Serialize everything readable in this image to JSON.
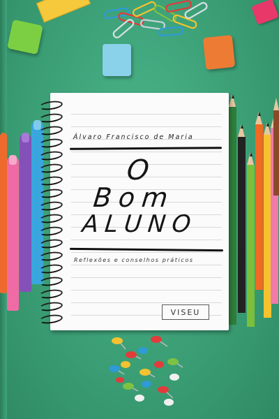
{
  "book": {
    "author": "Álvaro Francisco de Maria",
    "title_lines": [
      "O",
      "Bom",
      "Aluno"
    ],
    "subtitle": "Reflexões e conselhos práticos",
    "publisher": "VISEU"
  },
  "colors": {
    "background": "#3fa47c",
    "notebook": "#fbfbfb",
    "ink": "#151515"
  },
  "decorations": [
    "ruler",
    "paper-clips",
    "erasers",
    "sharpener",
    "markers",
    "colored-pencils",
    "push-pins",
    "spiral-notebook"
  ]
}
